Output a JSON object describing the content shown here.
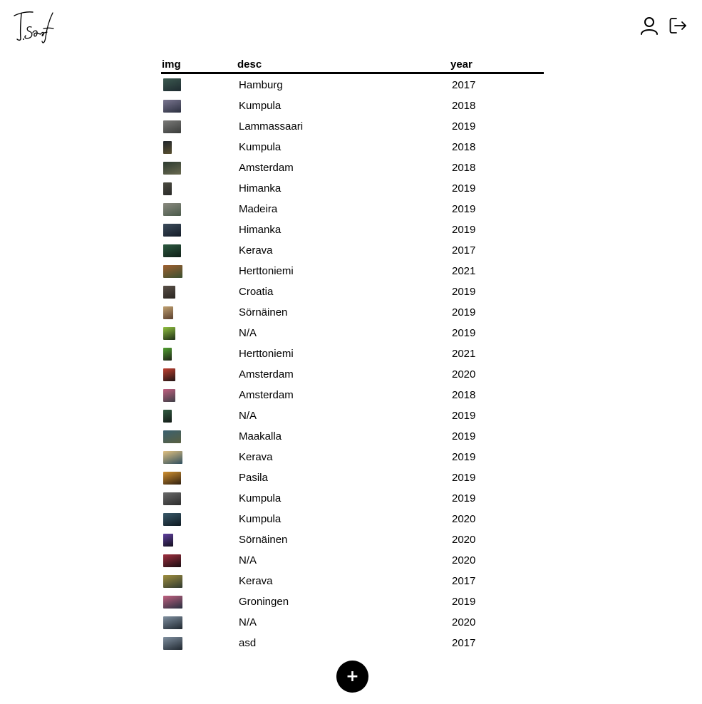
{
  "header": {
    "logo_alt": "T.Saaf signature",
    "user_icon": "user-icon",
    "logout_icon": "logout-icon"
  },
  "table": {
    "columns": [
      "img",
      "desc",
      "year"
    ],
    "rows": [
      {
        "desc": "Hamburg",
        "year": "2017",
        "thumb": "landscape",
        "colors": [
          "#3c5a50",
          "#1e2a30"
        ]
      },
      {
        "desc": "Kumpula",
        "year": "2018",
        "thumb": "landscape",
        "colors": [
          "#7a7690",
          "#2c3040"
        ]
      },
      {
        "desc": "Lammassaari",
        "year": "2019",
        "thumb": "landscape",
        "colors": [
          "#7a7a78",
          "#3a3c3a"
        ]
      },
      {
        "desc": "Kumpula",
        "year": "2018",
        "thumb": "portrait",
        "colors": [
          "#20262c",
          "#5a5030"
        ]
      },
      {
        "desc": "Amsterdam",
        "year": "2018",
        "thumb": "landscape",
        "colors": [
          "#2c3a30",
          "#6a6a50"
        ]
      },
      {
        "desc": "Himanka",
        "year": "2019",
        "thumb": "portrait",
        "colors": [
          "#4a4a40",
          "#2a2a28"
        ]
      },
      {
        "desc": "Madeira",
        "year": "2019",
        "thumb": "landscape",
        "colors": [
          "#8a8a80",
          "#4a5a4a"
        ]
      },
      {
        "desc": "Himanka",
        "year": "2019",
        "thumb": "landscape",
        "colors": [
          "#3c4c5c",
          "#141c28"
        ]
      },
      {
        "desc": "Kerava",
        "year": "2017",
        "thumb": "landscape",
        "colors": [
          "#2c5a40",
          "#102018"
        ]
      },
      {
        "desc": "Herttoniemi",
        "year": "2021",
        "thumb": "wide",
        "colors": [
          "#a06030",
          "#3a5030"
        ]
      },
      {
        "desc": "Croatia",
        "year": "2019",
        "thumb": "square",
        "colors": [
          "#5a5048",
          "#2a2622"
        ]
      },
      {
        "desc": "Sörnäinen",
        "year": "2019",
        "thumb": "portrait-wide",
        "colors": [
          "#c0a070",
          "#5a4030"
        ]
      },
      {
        "desc": "N/A",
        "year": "2019",
        "thumb": "square",
        "colors": [
          "#90c040",
          "#203018"
        ]
      },
      {
        "desc": "Herttoniemi",
        "year": "2021",
        "thumb": "portrait",
        "colors": [
          "#50a030",
          "#202418"
        ]
      },
      {
        "desc": "Amsterdam",
        "year": "2020",
        "thumb": "square",
        "colors": [
          "#c04030",
          "#201414"
        ]
      },
      {
        "desc": "Amsterdam",
        "year": "2018",
        "thumb": "square",
        "colors": [
          "#c06080",
          "#404048"
        ]
      },
      {
        "desc": "N/A",
        "year": "2019",
        "thumb": "portrait",
        "colors": [
          "#305a40",
          "#141c18"
        ]
      },
      {
        "desc": "Maakalla",
        "year": "2019",
        "thumb": "landscape",
        "colors": [
          "#3a6070",
          "#5a6040"
        ]
      },
      {
        "desc": "Kerava",
        "year": "2019",
        "thumb": "wide",
        "colors": [
          "#e0c080",
          "#305060"
        ]
      },
      {
        "desc": "Pasila",
        "year": "2019",
        "thumb": "landscape",
        "colors": [
          "#d09030",
          "#302010"
        ]
      },
      {
        "desc": "Kumpula",
        "year": "2019",
        "thumb": "landscape",
        "colors": [
          "#6a6a6a",
          "#2c2c2c"
        ]
      },
      {
        "desc": "Kumpula",
        "year": "2020",
        "thumb": "landscape",
        "colors": [
          "#3a5a6a",
          "#0e1a22"
        ]
      },
      {
        "desc": "Sörnäinen",
        "year": "2020",
        "thumb": "portrait-wide",
        "colors": [
          "#6040a0",
          "#14101e"
        ]
      },
      {
        "desc": "N/A",
        "year": "2020",
        "thumb": "landscape",
        "colors": [
          "#a03040",
          "#1a0e12"
        ]
      },
      {
        "desc": "Kerava",
        "year": "2017",
        "thumb": "wide",
        "colors": [
          "#a09040",
          "#303a30"
        ]
      },
      {
        "desc": "Groningen",
        "year": "2019",
        "thumb": "wide",
        "colors": [
          "#c06080",
          "#283040"
        ]
      },
      {
        "desc": "N/A",
        "year": "2020",
        "thumb": "wide",
        "colors": [
          "#8090a0",
          "#202830"
        ]
      },
      {
        "desc": "asd",
        "year": "2017",
        "thumb": "wide",
        "colors": [
          "#8090a0",
          "#202830"
        ]
      }
    ]
  },
  "actions": {
    "add_label": "+"
  }
}
